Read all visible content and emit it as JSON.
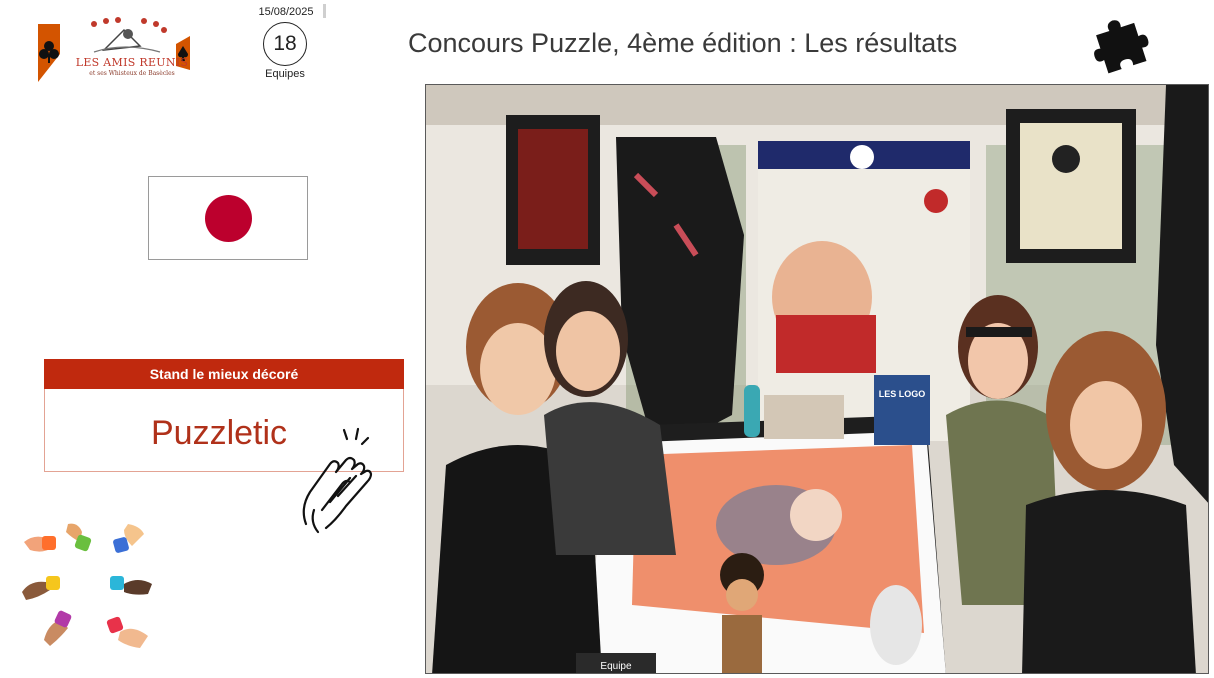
{
  "header": {
    "logo": {
      "name": "LES AMIS REUNIS",
      "subtitle": "et ses Whisteux de Basècles",
      "icon": "club-card-logo-icon"
    },
    "date": "15/08/2025",
    "team_count": "18",
    "team_label": "Equipes",
    "title": "Concours Puzzle, 4ème édition : Les résultats",
    "puzzle_icon": "puzzle-piece-icon"
  },
  "flag": {
    "country_icon": "japan-flag-icon",
    "disc_color": "#bc002d"
  },
  "award": {
    "category": "Stand le mieux décoré",
    "winner": "Puzzletic",
    "accent": "#c0290e",
    "icon": "clapping-hands-icon"
  },
  "decor": {
    "hands_icon": "hands-with-puzzle-pieces-icon"
  },
  "photo": {
    "icon": "team-photo",
    "table_sign": "Equipe",
    "box_text": "LES LOGO"
  }
}
